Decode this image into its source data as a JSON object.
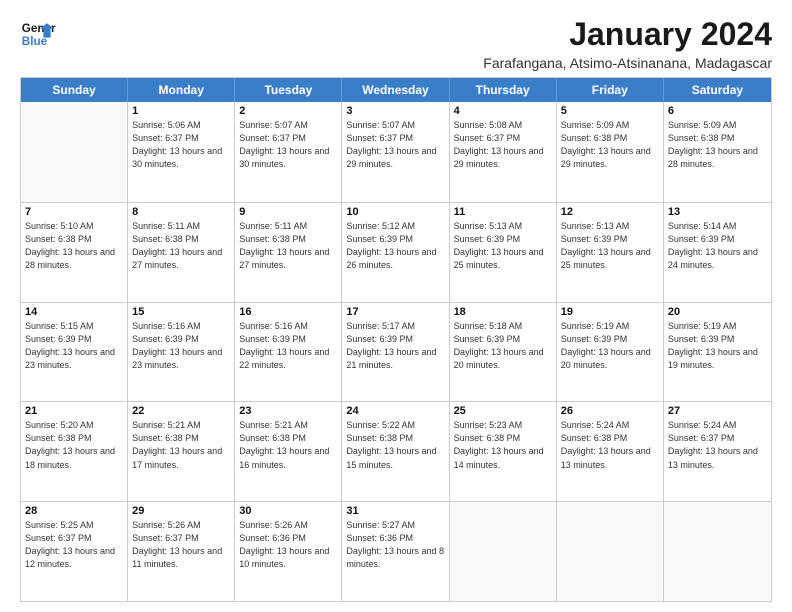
{
  "header": {
    "logo_line1": "General",
    "logo_line2": "Blue",
    "month": "January 2024",
    "location": "Farafangana, Atsimo-Atsinanana, Madagascar"
  },
  "days_of_week": [
    "Sunday",
    "Monday",
    "Tuesday",
    "Wednesday",
    "Thursday",
    "Friday",
    "Saturday"
  ],
  "weeks": [
    [
      {
        "day": "",
        "empty": true
      },
      {
        "day": "1",
        "sunrise": "5:06 AM",
        "sunset": "6:37 PM",
        "daylight": "13 hours and 30 minutes."
      },
      {
        "day": "2",
        "sunrise": "5:07 AM",
        "sunset": "6:37 PM",
        "daylight": "13 hours and 30 minutes."
      },
      {
        "day": "3",
        "sunrise": "5:07 AM",
        "sunset": "6:37 PM",
        "daylight": "13 hours and 29 minutes."
      },
      {
        "day": "4",
        "sunrise": "5:08 AM",
        "sunset": "6:37 PM",
        "daylight": "13 hours and 29 minutes."
      },
      {
        "day": "5",
        "sunrise": "5:09 AM",
        "sunset": "6:38 PM",
        "daylight": "13 hours and 29 minutes."
      },
      {
        "day": "6",
        "sunrise": "5:09 AM",
        "sunset": "6:38 PM",
        "daylight": "13 hours and 28 minutes."
      }
    ],
    [
      {
        "day": "7",
        "sunrise": "5:10 AM",
        "sunset": "6:38 PM",
        "daylight": "13 hours and 28 minutes."
      },
      {
        "day": "8",
        "sunrise": "5:11 AM",
        "sunset": "6:38 PM",
        "daylight": "13 hours and 27 minutes."
      },
      {
        "day": "9",
        "sunrise": "5:11 AM",
        "sunset": "6:38 PM",
        "daylight": "13 hours and 27 minutes."
      },
      {
        "day": "10",
        "sunrise": "5:12 AM",
        "sunset": "6:39 PM",
        "daylight": "13 hours and 26 minutes."
      },
      {
        "day": "11",
        "sunrise": "5:13 AM",
        "sunset": "6:39 PM",
        "daylight": "13 hours and 25 minutes."
      },
      {
        "day": "12",
        "sunrise": "5:13 AM",
        "sunset": "6:39 PM",
        "daylight": "13 hours and 25 minutes."
      },
      {
        "day": "13",
        "sunrise": "5:14 AM",
        "sunset": "6:39 PM",
        "daylight": "13 hours and 24 minutes."
      }
    ],
    [
      {
        "day": "14",
        "sunrise": "5:15 AM",
        "sunset": "6:39 PM",
        "daylight": "13 hours and 23 minutes."
      },
      {
        "day": "15",
        "sunrise": "5:16 AM",
        "sunset": "6:39 PM",
        "daylight": "13 hours and 23 minutes."
      },
      {
        "day": "16",
        "sunrise": "5:16 AM",
        "sunset": "6:39 PM",
        "daylight": "13 hours and 22 minutes."
      },
      {
        "day": "17",
        "sunrise": "5:17 AM",
        "sunset": "6:39 PM",
        "daylight": "13 hours and 21 minutes."
      },
      {
        "day": "18",
        "sunrise": "5:18 AM",
        "sunset": "6:39 PM",
        "daylight": "13 hours and 20 minutes."
      },
      {
        "day": "19",
        "sunrise": "5:19 AM",
        "sunset": "6:39 PM",
        "daylight": "13 hours and 20 minutes."
      },
      {
        "day": "20",
        "sunrise": "5:19 AM",
        "sunset": "6:39 PM",
        "daylight": "13 hours and 19 minutes."
      }
    ],
    [
      {
        "day": "21",
        "sunrise": "5:20 AM",
        "sunset": "6:38 PM",
        "daylight": "13 hours and 18 minutes."
      },
      {
        "day": "22",
        "sunrise": "5:21 AM",
        "sunset": "6:38 PM",
        "daylight": "13 hours and 17 minutes."
      },
      {
        "day": "23",
        "sunrise": "5:21 AM",
        "sunset": "6:38 PM",
        "daylight": "13 hours and 16 minutes."
      },
      {
        "day": "24",
        "sunrise": "5:22 AM",
        "sunset": "6:38 PM",
        "daylight": "13 hours and 15 minutes."
      },
      {
        "day": "25",
        "sunrise": "5:23 AM",
        "sunset": "6:38 PM",
        "daylight": "13 hours and 14 minutes."
      },
      {
        "day": "26",
        "sunrise": "5:24 AM",
        "sunset": "6:38 PM",
        "daylight": "13 hours and 13 minutes."
      },
      {
        "day": "27",
        "sunrise": "5:24 AM",
        "sunset": "6:37 PM",
        "daylight": "13 hours and 13 minutes."
      }
    ],
    [
      {
        "day": "28",
        "sunrise": "5:25 AM",
        "sunset": "6:37 PM",
        "daylight": "13 hours and 12 minutes."
      },
      {
        "day": "29",
        "sunrise": "5:26 AM",
        "sunset": "6:37 PM",
        "daylight": "13 hours and 11 minutes."
      },
      {
        "day": "30",
        "sunrise": "5:26 AM",
        "sunset": "6:36 PM",
        "daylight": "13 hours and 10 minutes."
      },
      {
        "day": "31",
        "sunrise": "5:27 AM",
        "sunset": "6:36 PM",
        "daylight": "13 hours and 8 minutes."
      },
      {
        "day": "",
        "empty": true
      },
      {
        "day": "",
        "empty": true
      },
      {
        "day": "",
        "empty": true
      }
    ]
  ]
}
